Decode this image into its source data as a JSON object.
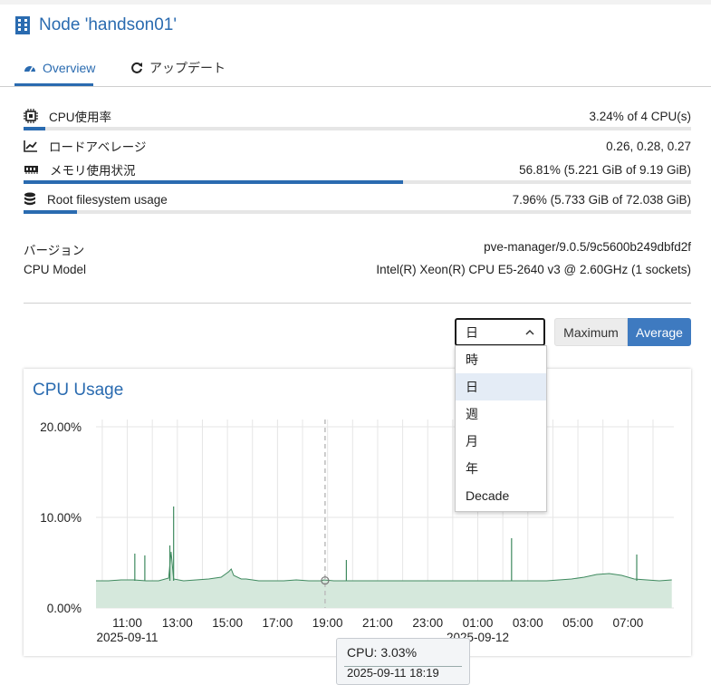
{
  "header": {
    "title": "Node 'handson01'"
  },
  "tabs": [
    {
      "label": "Overview",
      "icon": "dashboard-icon"
    },
    {
      "label": "アップデート",
      "icon": "refresh-icon"
    }
  ],
  "metrics": [
    {
      "label": "CPU使用率",
      "value": "3.24% of 4 CPU(s)",
      "icon": "cpu-icon",
      "bar_percent": 3.24
    },
    {
      "label": "ロードアベレージ",
      "value": "0.26, 0.28, 0.27",
      "icon": "line-chart-icon"
    },
    {
      "label": "メモリ使用状況",
      "value": "56.81% (5.221 GiB of 9.19 GiB)",
      "icon": "memory-icon",
      "bar_percent": 56.81
    },
    {
      "label": "Root filesystem usage",
      "value": "7.96% (5.733 GiB of 72.038 GiB)",
      "icon": "database-icon",
      "bar_percent": 7.96
    }
  ],
  "info": [
    {
      "label": "バージョン",
      "value": "pve-manager/9.0.5/9c5600b249dbfd2f"
    },
    {
      "label": "CPU Model",
      "value": "Intel(R) Xeon(R) CPU E5-2640 v3 @ 2.60GHz (1 sockets)"
    }
  ],
  "controls": {
    "timeframe_selected": "日",
    "timeframe_options": [
      "時",
      "日",
      "週",
      "月",
      "年",
      "Decade"
    ],
    "maximum_label": "Maximum",
    "average_label": "Average"
  },
  "tooltip": {
    "line1": "CPU: 3.03%",
    "line2": "2025-09-11 18:19"
  },
  "colors": {
    "accent": "#2a6bb0",
    "series_fill": "#d5e8dc",
    "series_line": "#3f8a5f"
  },
  "chart_data": {
    "type": "area",
    "title": "CPU Usage",
    "y_unit": "%",
    "ylim": [
      0,
      20
    ],
    "y_ticks": [
      "0.00%",
      "10.00%",
      "20.00%"
    ],
    "x_range": [
      "2025-09-11 09:45",
      "2025-09-12 08:50"
    ],
    "x_ticks": [
      "11:00",
      "13:00",
      "15:00",
      "17:00",
      "19:00",
      "21:00",
      "23:00",
      "01:00",
      "03:00",
      "05:00",
      "07:00"
    ],
    "x_date_labels": [
      "2025-09-11",
      "2025-09-12"
    ],
    "grid": true,
    "series": [
      {
        "name": "CPU",
        "x_hours": [
          0,
          0.5,
          1,
          1.5,
          2,
          2.5,
          2.9,
          3,
          3.1,
          3.5,
          4,
          4.5,
          5,
          5.3,
          5.4,
          5.5,
          5.8,
          6,
          6.5,
          7,
          7.5,
          8,
          8.5,
          8.9,
          9,
          9.1,
          9.5,
          10,
          10.5,
          11,
          11.5,
          12,
          12.5,
          13,
          13.5,
          14,
          14.5,
          15,
          15.5,
          16,
          16.5,
          17,
          17.5,
          18,
          18.5,
          19,
          19.5,
          20,
          20.5,
          21,
          21.5,
          22,
          22.5,
          23
        ],
        "values": [
          3.0,
          3.0,
          3.1,
          3.1,
          3.0,
          3.0,
          3.3,
          6.2,
          3.2,
          3.0,
          3.1,
          3.2,
          3.4,
          4.0,
          4.3,
          3.6,
          3.2,
          3.2,
          3.0,
          3.0,
          3.0,
          3.1,
          3.0,
          3.0,
          3.0,
          3.1,
          3.0,
          3.0,
          3.0,
          3.0,
          3.0,
          3.0,
          3.0,
          3.0,
          3.0,
          3.0,
          3.0,
          3.0,
          3.0,
          3.0,
          3.0,
          3.0,
          3.0,
          3.0,
          3.1,
          3.2,
          3.4,
          3.7,
          3.8,
          3.6,
          3.2,
          3.1,
          3.0,
          3.1
        ]
      }
    ]
  }
}
